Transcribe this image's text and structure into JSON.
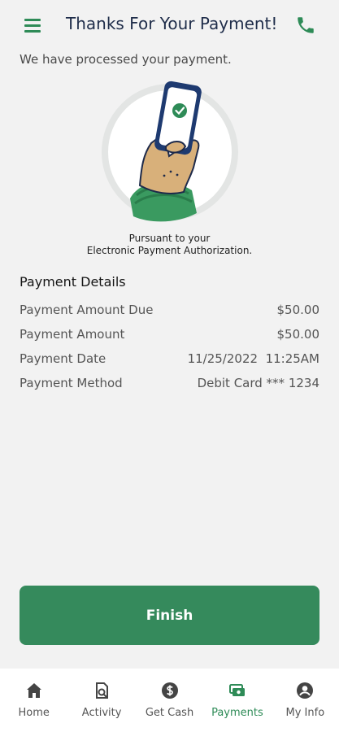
{
  "header": {
    "title": "Thanks For Your Payment!"
  },
  "subtitle": "We have processed your payment.",
  "authorization_note": {
    "line1": "Pursuant to your",
    "line2": "Electronic Payment Authorization."
  },
  "payment_details": {
    "title": "Payment Details",
    "rows": [
      {
        "label": "Payment Amount Due",
        "value": "$50.00"
      },
      {
        "label": "Payment Amount",
        "value": "$50.00"
      },
      {
        "label": "Payment Date",
        "value": "11/25/2022  11:25AM"
      },
      {
        "label": "Payment Method",
        "value": "Debit Card *** 1234"
      }
    ]
  },
  "finish_button": {
    "label": "Finish"
  },
  "bottom_nav": {
    "items": [
      {
        "label": "Home",
        "icon": "home-icon"
      },
      {
        "label": "Activity",
        "icon": "activity-icon"
      },
      {
        "label": "Get Cash",
        "icon": "dollar-icon"
      },
      {
        "label": "Payments",
        "icon": "payments-icon",
        "active": true
      },
      {
        "label": "My Info",
        "icon": "user-icon"
      }
    ]
  },
  "colors": {
    "brand_green": "#358a5c",
    "nav_active": "#2e8b57",
    "title_navy": "#1f2d4a",
    "background": "#f2f2f2"
  }
}
